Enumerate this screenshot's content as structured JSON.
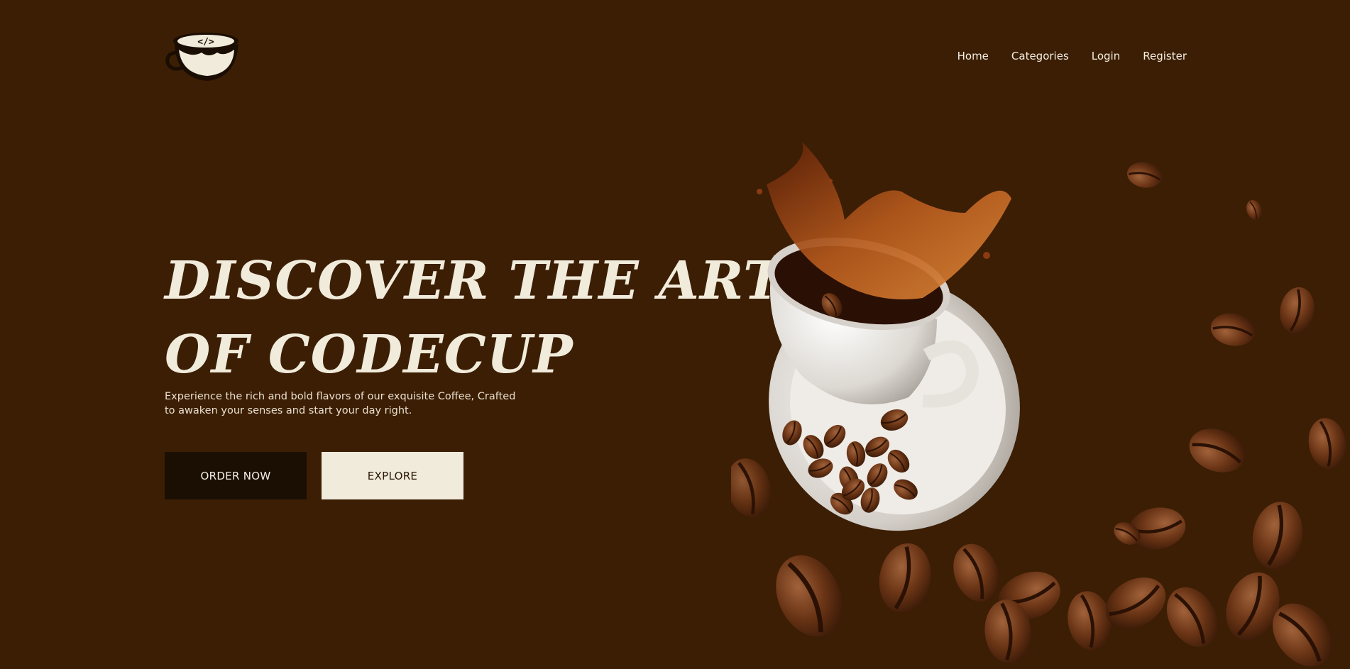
{
  "header": {
    "logo_icon": "coffee-cup-code-icon",
    "nav": [
      {
        "label": "Home"
      },
      {
        "label": "Categories"
      },
      {
        "label": "Login"
      },
      {
        "label": "Register"
      }
    ]
  },
  "hero": {
    "title_line1": "DISCOVER THE ART",
    "title_line2": "OF CODECUP",
    "subtitle": "Experience the rich and bold flavors of our exquisite Coffee, Crafted to awaken your senses and start your day right.",
    "order_label": "ORDER NOW",
    "explore_label": "EXPLORE"
  },
  "illustration": {
    "icon": "coffee-cup-splash-beans-illustration"
  },
  "colors": {
    "background": "#3b1e04",
    "headline": "#f1ebdb",
    "order_button": "#1b0f04",
    "explore_button": "#f0ebdb"
  }
}
